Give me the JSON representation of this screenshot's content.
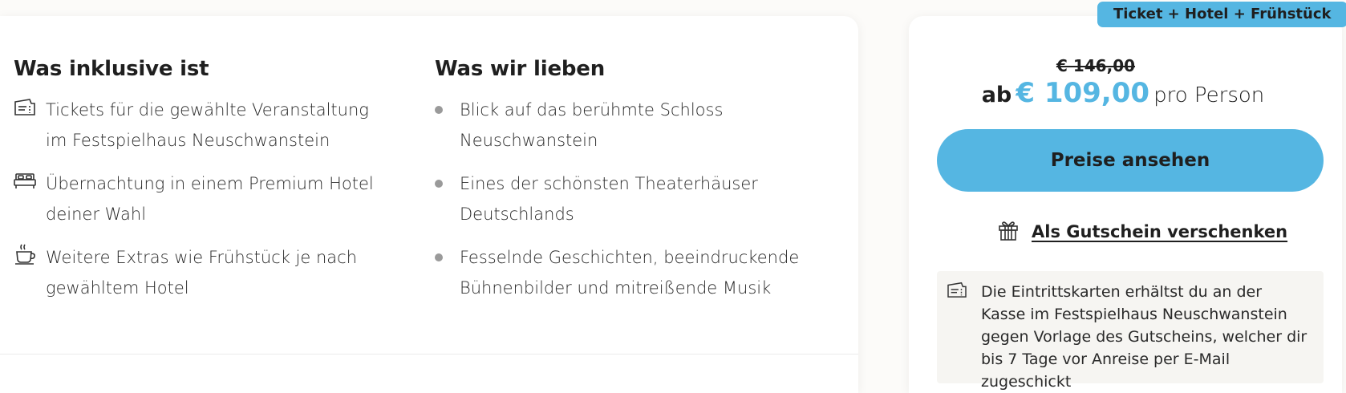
{
  "badge": "Ticket + Hotel + Frühstück",
  "included": {
    "title": "Was inklusive ist",
    "items": [
      {
        "icon": "ticket-icon",
        "text": "Tickets für die gewählte Veranstaltung im Festspielhaus Neuschwanstein"
      },
      {
        "icon": "bed-icon",
        "text": "Übernachtung in einem Premium Hotel deiner Wahl"
      },
      {
        "icon": "coffee-cup-icon",
        "text": "Weitere Extras wie Frühstück je nach gewähltem Hotel"
      }
    ]
  },
  "love": {
    "title": "Was wir lieben",
    "items": [
      "Blick auf das berühmte Schloss Neuschwanstein",
      "Eines der schönsten Theaterhäuser Deutschlands",
      "Fesselnde Geschichten, beeindruckende Bühnenbilder und mitreißende Musik"
    ]
  },
  "pricing": {
    "old_price": "€ 146,00",
    "prefix": "ab",
    "price": "€ 109,00",
    "suffix": "pro Person",
    "cta_label": "Preise ansehen",
    "gift_label": "Als Gutschein verschenken",
    "info_text": "Die Eintrittskarten erhältst du an der Kasse im Festspielhaus Neuschwanstein gegen Vorlage des Gutscheins, welcher dir bis 7 Tage vor Anreise per E-Mail zugeschickt"
  },
  "colors": {
    "accent": "#55b6e2",
    "text": "#1f1f1f",
    "bullet": "#9a9a9a",
    "info_bg": "#f6f5f2"
  }
}
